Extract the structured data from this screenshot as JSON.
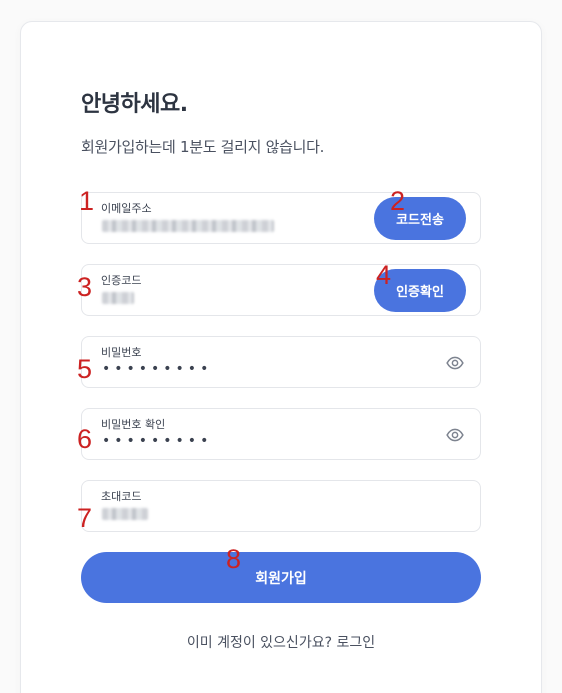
{
  "header": {
    "title": "안녕하세요.",
    "subtitle": "회원가입하는데 1분도 걸리지 않습니다."
  },
  "fields": {
    "email": {
      "label": "이메일주소",
      "value_redacted": true
    },
    "code": {
      "label": "인증코드",
      "value_redacted": true
    },
    "password": {
      "label": "비밀번호",
      "value": "•••••••••"
    },
    "password_confirm": {
      "label": "비밀번호 확인",
      "value": "•••••••••"
    },
    "invite_code": {
      "label": "초대코드",
      "value_redacted": true
    }
  },
  "buttons": {
    "send_code": "코드전송",
    "verify_code": "인증확인",
    "signup": "회원가입"
  },
  "footer": {
    "login_link": "이미 계정이 있으신가요? 로그인"
  },
  "annotations": [
    "1",
    "2",
    "3",
    "4",
    "5",
    "6",
    "7",
    "8"
  ],
  "colors": {
    "accent": "#4a74df",
    "annotation": "#cc2222",
    "text": "#2d3441"
  },
  "icons": {
    "password_toggle": "eye-icon"
  }
}
